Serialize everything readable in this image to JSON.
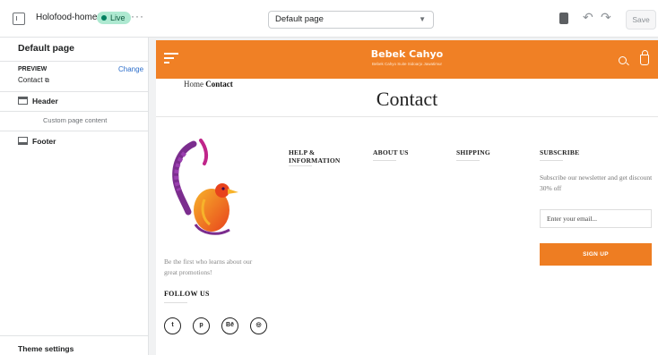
{
  "topbar": {
    "theme_name": "Holofood-home2",
    "status_badge": "Live",
    "more": "···",
    "page_select_value": "Default page",
    "save_label": "Save"
  },
  "sidebar": {
    "title": "Default page",
    "preview_label": "PREVIEW",
    "preview_value": "Contact",
    "change_label": "Change",
    "header_label": "Header",
    "custom_content_label": "Custom page content",
    "footer_label": "Footer",
    "theme_settings_label": "Theme settings"
  },
  "store": {
    "brand": "Bebek Cahyo",
    "tagline": "Bebek Cahyo Suite Sidoarjo Jawatimur",
    "header_color": "#f08025",
    "breadcrumb_home": "Home",
    "breadcrumb_current": "Contact",
    "page_title": "Contact"
  },
  "footer": {
    "blurb": "Be the first who learns about our great promotions!",
    "follow_label": "FOLLOW US",
    "columns": [
      "HELP & INFORMATION",
      "ABOUT US",
      "SHIPPING",
      "SUBSCRIBE"
    ],
    "subscribe_text": "Subscribe our newsletter and get discount 30% off",
    "email_placeholder": "Enter your email...",
    "signup_label": "SIGN UP",
    "social_icons": [
      "twitter-icon",
      "pinterest-icon",
      "behance-icon",
      "dribbble-icon"
    ],
    "accent_color": "#ee7d22"
  }
}
